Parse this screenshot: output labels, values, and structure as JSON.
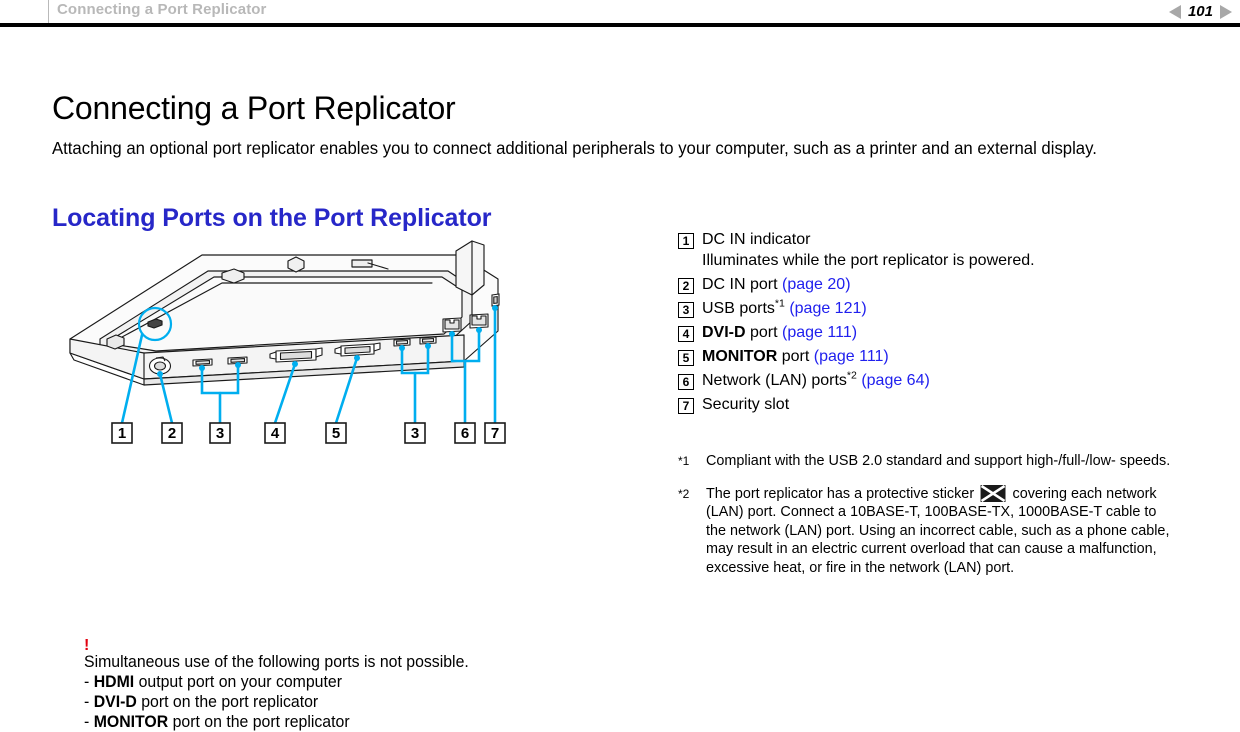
{
  "header": {
    "breadcrumb": "Connecting a Port Replicator",
    "page_number": "101",
    "prev_icon": "triangle-left-icon",
    "next_icon": "triangle-right-icon"
  },
  "document": {
    "title": "Connecting a Port Replicator",
    "intro": "Attaching an optional port replicator enables you to connect additional peripherals to your computer, such as a printer and an external display.",
    "subtitle": "Locating Ports on the Port Replicator"
  },
  "illustration": {
    "name": "port-replicator-rear-view-diagram",
    "callouts": [
      "1",
      "2",
      "3",
      "4",
      "5",
      "3",
      "6",
      "7"
    ]
  },
  "port_list": [
    {
      "num": "1",
      "label": "DC IN indicator",
      "bold": "",
      "suffix": "",
      "footnote": "",
      "link": "",
      "description": "Illuminates while the port replicator is powered."
    },
    {
      "num": "2",
      "label": "DC IN port",
      "bold": "",
      "suffix": "",
      "footnote": "",
      "link": "(page 20)",
      "description": ""
    },
    {
      "num": "3",
      "label": "USB ports",
      "bold": "",
      "suffix": "",
      "footnote": "*1",
      "link": "(page 121)",
      "description": ""
    },
    {
      "num": "4",
      "label": " port",
      "bold": "DVI-D",
      "suffix": "",
      "footnote": "",
      "link": "(page 111)",
      "description": ""
    },
    {
      "num": "5",
      "label": " port",
      "bold": "MONITOR",
      "suffix": "",
      "footnote": "",
      "link": "(page 111)",
      "description": ""
    },
    {
      "num": "6",
      "label": "Network (LAN) ports",
      "bold": "",
      "suffix": "",
      "footnote": "*2",
      "link": "(page 64)",
      "description": ""
    },
    {
      "num": "7",
      "label": "Security slot",
      "bold": "",
      "suffix": "",
      "footnote": "",
      "link": "",
      "description": ""
    }
  ],
  "footnotes": [
    {
      "mark": "*1",
      "text": "Compliant with the USB 2.0 standard and support high-/full-/low- speeds.",
      "has_icon": false,
      "icon_name": "",
      "text_before_icon": "",
      "text_after_icon": ""
    },
    {
      "mark": "*2",
      "text": "",
      "has_icon": true,
      "icon_name": "crossed-out-lan-sticker-icon",
      "text_before_icon": "The port replicator has a protective sticker",
      "text_after_icon": "covering each network (LAN) port. Connect a 10BASE-T, 100BASE-TX, 1000BASE-T cable to the network (LAN) port. Using an incorrect cable, such as a phone cable, may result in an electric current overload that can cause a malfunction, excessive heat, or fire in the network (LAN) port."
    }
  ],
  "note": {
    "marker": "!",
    "marker_color": "#e2000f",
    "intro": "Simultaneous use of the following ports is not possible.",
    "items": [
      {
        "dash": "- ",
        "bold": "HDMI",
        "rest": " output port on your computer"
      },
      {
        "dash": "- ",
        "bold": "DVI-D",
        "rest": " port on the port replicator"
      },
      {
        "dash": "- ",
        "bold": "MONITOR",
        "rest": " port on the port replicator"
      }
    ]
  },
  "colors": {
    "link_blue": "#2020ee",
    "heading_blue": "#2727c8",
    "callout_cyan": "#00aeef",
    "breadcrumb_gray": "#b8b8b8",
    "alert_red": "#e2000f"
  }
}
